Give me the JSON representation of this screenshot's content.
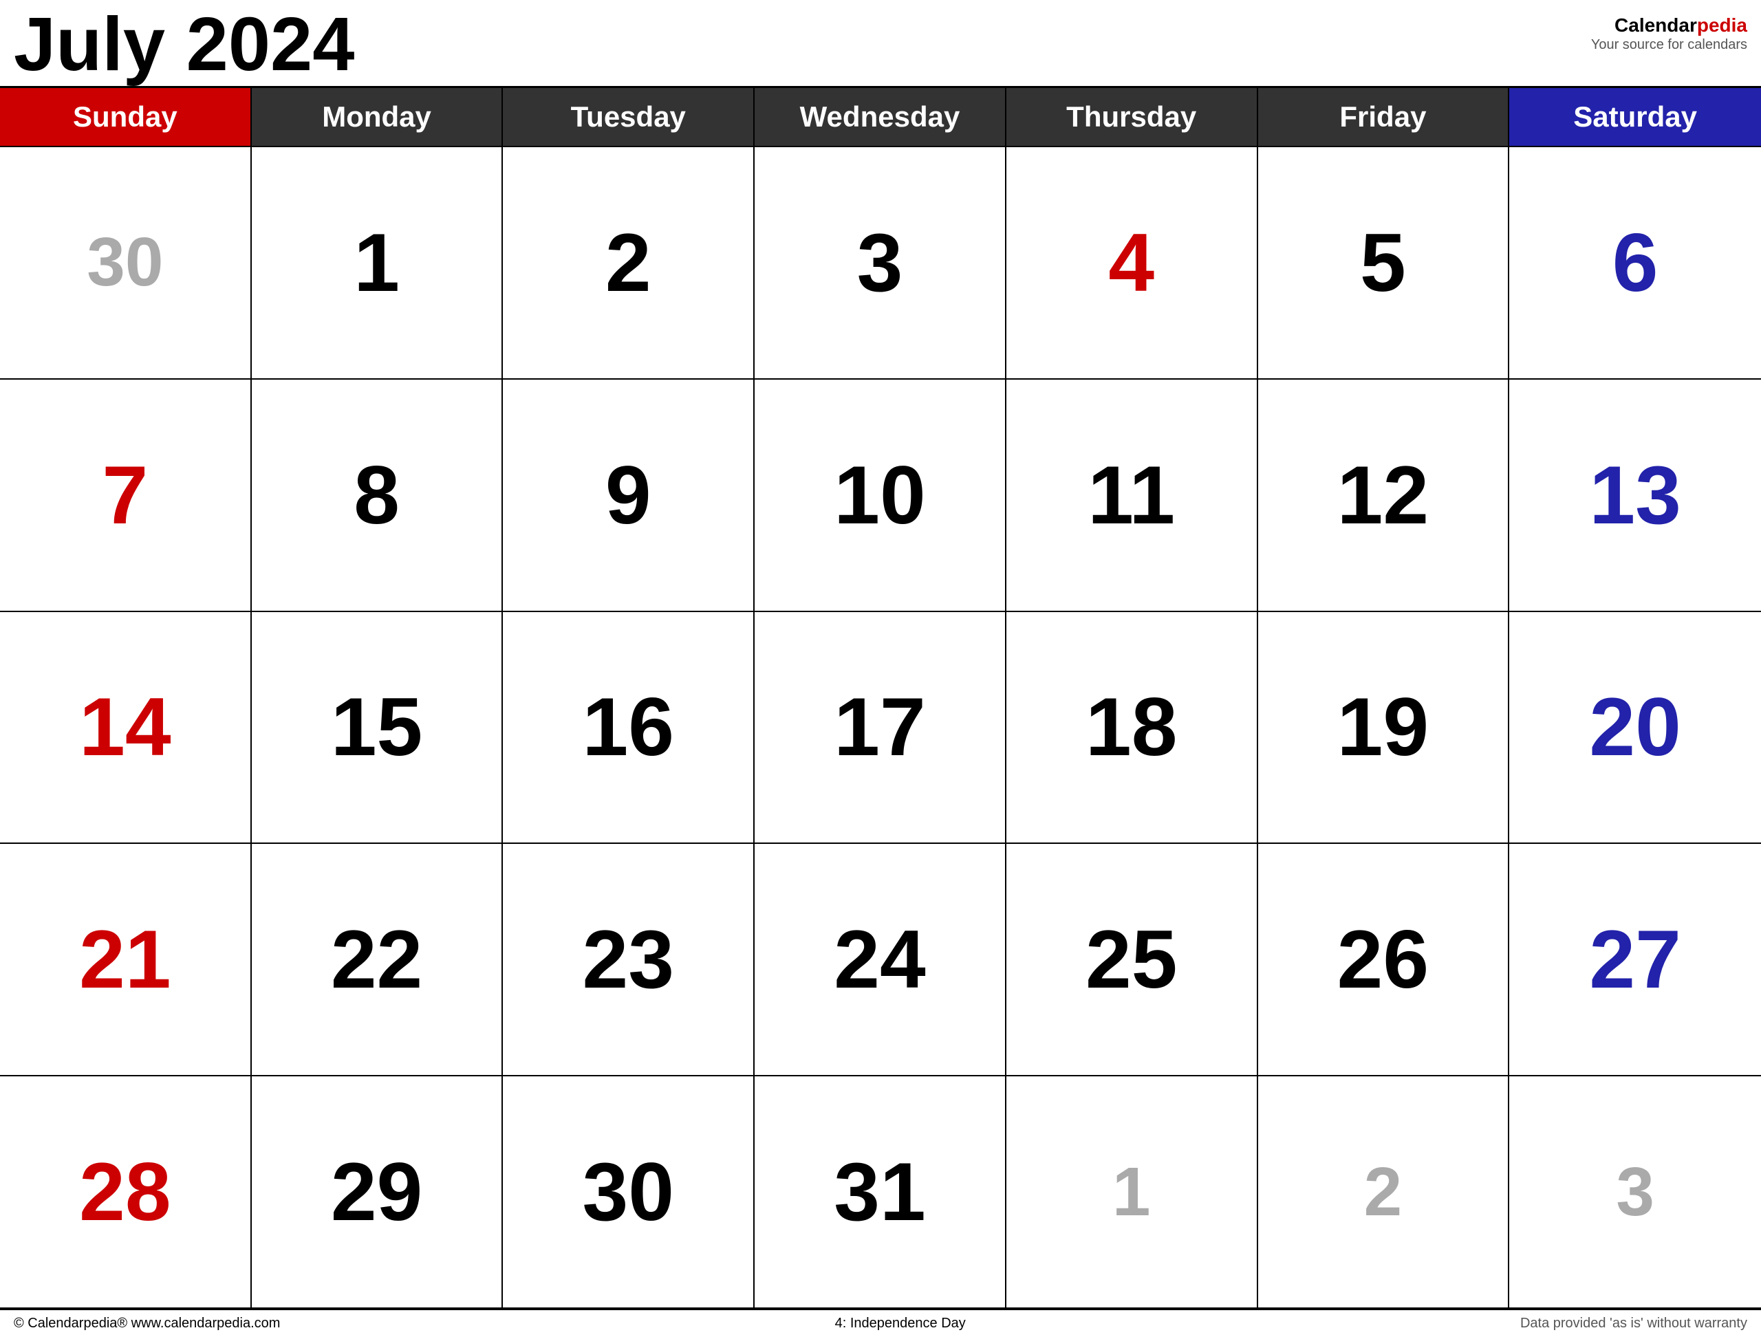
{
  "header": {
    "title": "July 2024",
    "logo": {
      "name": "Calendar",
      "name_accent": "pedia",
      "tagline": "Your source for calendars"
    }
  },
  "day_headers": [
    {
      "label": "Sunday",
      "type": "sunday"
    },
    {
      "label": "Monday",
      "type": "weekday"
    },
    {
      "label": "Tuesday",
      "type": "weekday"
    },
    {
      "label": "Wednesday",
      "type": "weekday"
    },
    {
      "label": "Thursday",
      "type": "weekday"
    },
    {
      "label": "Friday",
      "type": "weekday"
    },
    {
      "label": "Saturday",
      "type": "saturday"
    }
  ],
  "weeks": [
    [
      {
        "day": "30",
        "type": "grayed"
      },
      {
        "day": "1",
        "type": "weekday"
      },
      {
        "day": "2",
        "type": "weekday"
      },
      {
        "day": "3",
        "type": "weekday"
      },
      {
        "day": "4",
        "type": "thursday-holiday"
      },
      {
        "day": "5",
        "type": "weekday"
      },
      {
        "day": "6",
        "type": "saturday"
      }
    ],
    [
      {
        "day": "7",
        "type": "sunday"
      },
      {
        "day": "8",
        "type": "weekday"
      },
      {
        "day": "9",
        "type": "weekday"
      },
      {
        "day": "10",
        "type": "weekday"
      },
      {
        "day": "11",
        "type": "weekday"
      },
      {
        "day": "12",
        "type": "weekday"
      },
      {
        "day": "13",
        "type": "saturday"
      }
    ],
    [
      {
        "day": "14",
        "type": "sunday"
      },
      {
        "day": "15",
        "type": "weekday"
      },
      {
        "day": "16",
        "type": "weekday"
      },
      {
        "day": "17",
        "type": "weekday"
      },
      {
        "day": "18",
        "type": "weekday"
      },
      {
        "day": "19",
        "type": "weekday"
      },
      {
        "day": "20",
        "type": "saturday"
      }
    ],
    [
      {
        "day": "21",
        "type": "sunday"
      },
      {
        "day": "22",
        "type": "weekday"
      },
      {
        "day": "23",
        "type": "weekday"
      },
      {
        "day": "24",
        "type": "weekday"
      },
      {
        "day": "25",
        "type": "weekday"
      },
      {
        "day": "26",
        "type": "weekday"
      },
      {
        "day": "27",
        "type": "saturday"
      }
    ],
    [
      {
        "day": "28",
        "type": "sunday"
      },
      {
        "day": "29",
        "type": "weekday"
      },
      {
        "day": "30",
        "type": "weekday"
      },
      {
        "day": "31",
        "type": "weekday"
      },
      {
        "day": "1",
        "type": "grayed"
      },
      {
        "day": "2",
        "type": "grayed"
      },
      {
        "day": "3",
        "type": "grayed"
      }
    ]
  ],
  "footer": {
    "left": "© Calendarpedia®   www.calendarpedia.com",
    "center": "4: Independence Day",
    "right": "Data provided 'as is' without warranty"
  }
}
